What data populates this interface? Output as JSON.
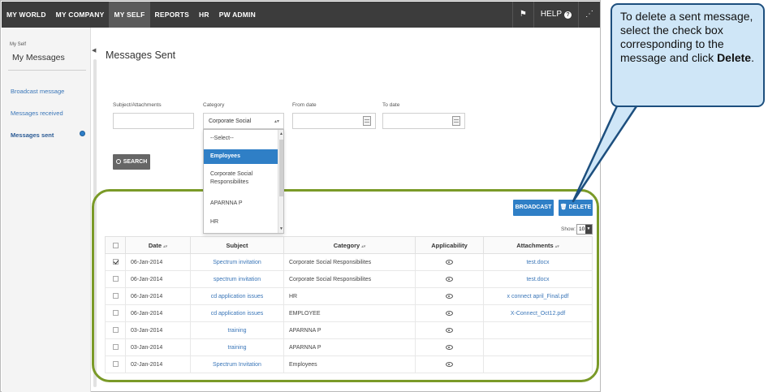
{
  "topbar": {
    "nav": [
      "MY WORLD",
      "MY COMPANY",
      "MY SELF",
      "REPORTS",
      "HR",
      "PW ADMIN"
    ],
    "active_index": 2,
    "help_label": "HELP"
  },
  "sidebar": {
    "small_label": "My Self",
    "title": "My Messages",
    "items": [
      "Broadcast message",
      "Messages received",
      "Messages sent"
    ],
    "active_index": 2
  },
  "main": {
    "title": "Messages Sent",
    "filters": {
      "subject_label": "Subject/Attachments",
      "category_label": "Category",
      "from_label": "From date",
      "to_label": "To date",
      "category_value": "Corporate Social"
    },
    "dropdown_options": [
      "--Select--",
      "Employees",
      "Corporate Social Responsibilites",
      "APARNNA P",
      "HR"
    ],
    "dropdown_selected": 1,
    "search_label": "SEARCH",
    "broadcast_label": "BROADCAST",
    "delete_label": "DELETE",
    "show_label": "Show:",
    "show_value": "10",
    "table": {
      "headers": [
        "Date",
        "Subject",
        "Category",
        "Applicability",
        "Attachments"
      ],
      "rows": [
        {
          "checked": true,
          "date": "06-Jan-2014",
          "subject": "Spectrum invitation",
          "category": "Corporate Social Responsibilites",
          "attachment": "test.docx"
        },
        {
          "checked": false,
          "date": "06-Jan-2014",
          "subject": "spectrum invitation",
          "category": "Corporate Social Responsibilites",
          "attachment": "test.docx"
        },
        {
          "checked": false,
          "date": "06-Jan-2014",
          "subject": "cd application issues",
          "category": "HR",
          "attachment": "x connect april_Final.pdf"
        },
        {
          "checked": false,
          "date": "06-Jan-2014",
          "subject": "cd application issues",
          "category": "EMPLOYEE",
          "attachment": "X-Connect_Oct12.pdf"
        },
        {
          "checked": false,
          "date": "03-Jan-2014",
          "subject": "training",
          "category": "APARNNA P",
          "attachment": ""
        },
        {
          "checked": false,
          "date": "03-Jan-2014",
          "subject": "training",
          "category": "APARNNA P",
          "attachment": ""
        },
        {
          "checked": false,
          "date": "02-Jan-2014",
          "subject": "Spectrum Invitation",
          "category": "Employees",
          "attachment": ""
        }
      ]
    }
  },
  "callout": {
    "text_before": "To delete a sent message, select the check box corresponding to the message and click ",
    "bold": "Delete",
    "text_after": "."
  },
  "colors": {
    "topbar": "#3c3c3c",
    "accent": "#2f7fc6",
    "highlight": "#7a9a28",
    "callout_fill": "#cfe6f7",
    "callout_border": "#1d4f7e"
  }
}
